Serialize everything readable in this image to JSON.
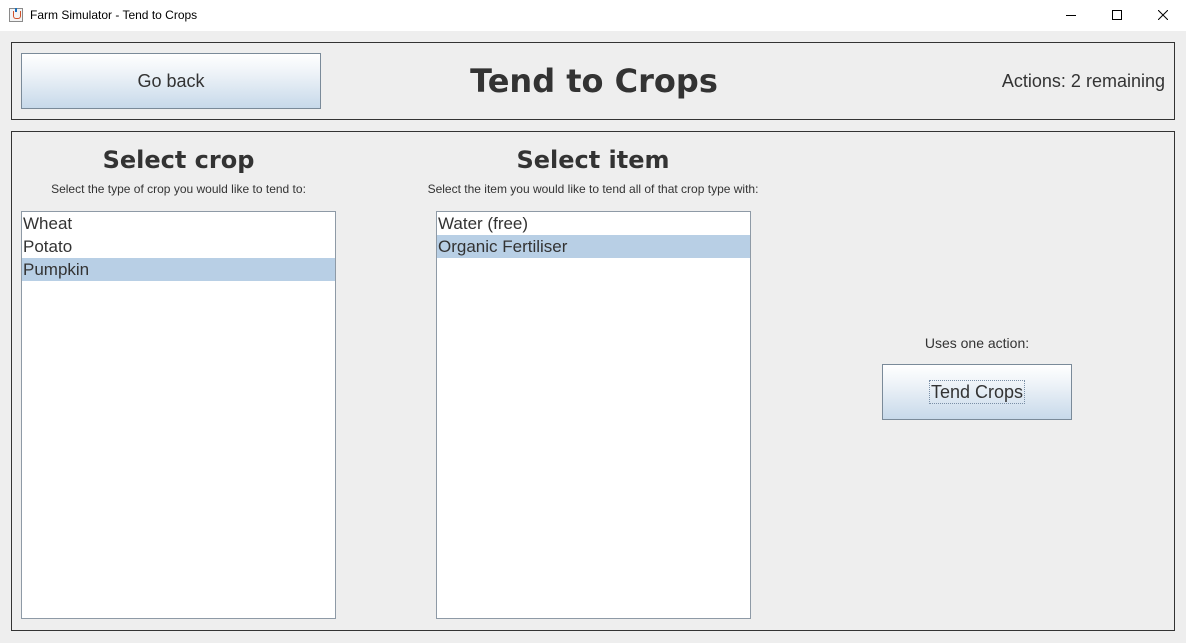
{
  "window": {
    "title": "Farm Simulator - Tend to Crops"
  },
  "header": {
    "back_label": "Go back",
    "title": "Tend to Crops",
    "actions_text": "Actions: 2 remaining"
  },
  "crop_panel": {
    "heading": "Select crop",
    "description": "Select the type of crop you would like to tend to:",
    "items": [
      {
        "label": "Wheat",
        "selected": false
      },
      {
        "label": "Potato",
        "selected": false
      },
      {
        "label": "Pumpkin",
        "selected": true
      }
    ]
  },
  "item_panel": {
    "heading": "Select item",
    "description": "Select the item you would like to tend all of that crop type with:",
    "items": [
      {
        "label": "Water (free)",
        "selected": false
      },
      {
        "label": "Organic Fertiliser",
        "selected": true
      }
    ]
  },
  "action_panel": {
    "note": "Uses one action:",
    "button_label": "Tend Crops"
  },
  "colors": {
    "selection": "#b8cfe5",
    "background": "#eeeeee",
    "text": "#333333"
  }
}
